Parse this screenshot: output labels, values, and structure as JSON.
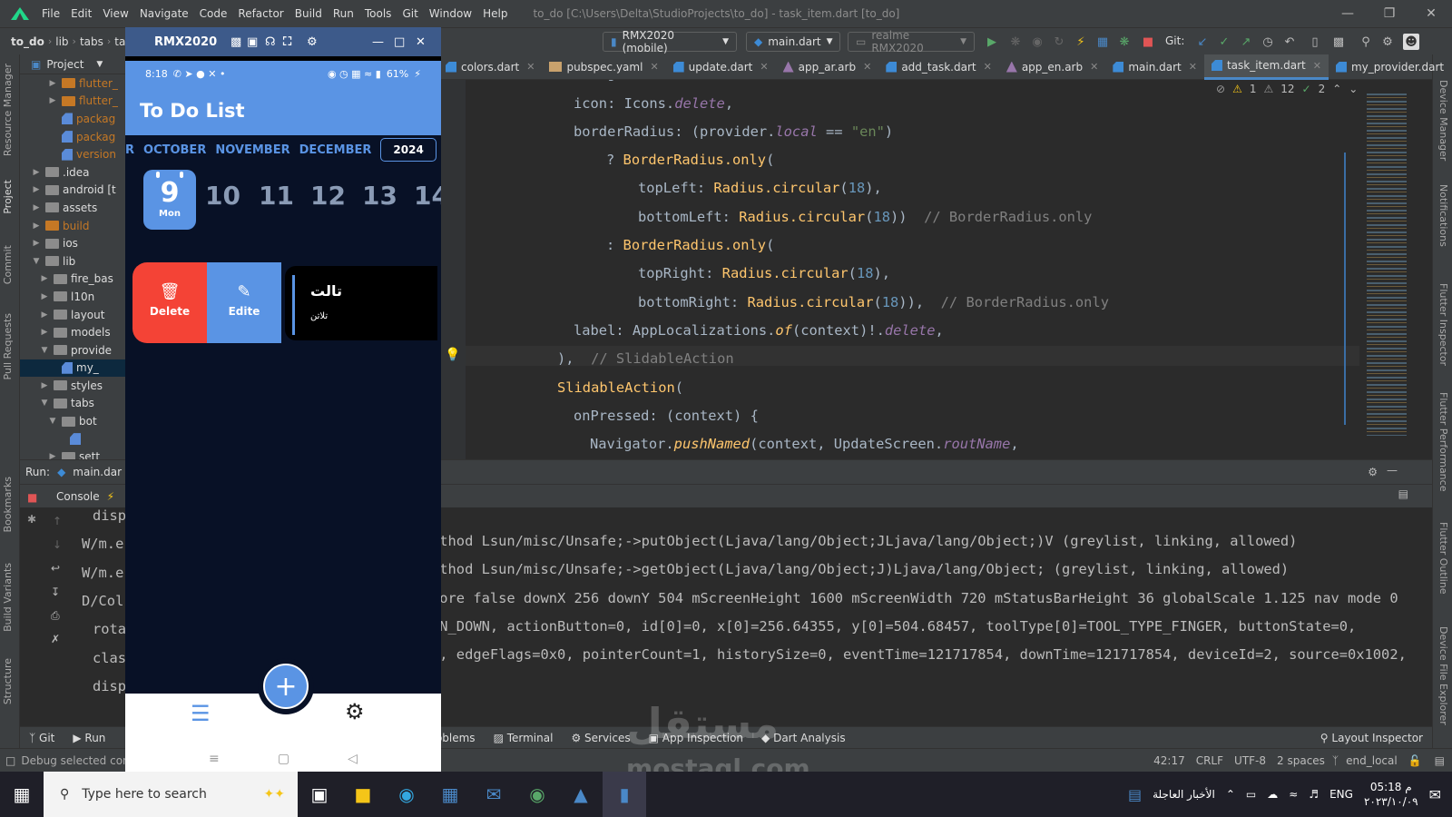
{
  "menubar": {
    "items": [
      "File",
      "Edit",
      "View",
      "Navigate",
      "Code",
      "Refactor",
      "Build",
      "Run",
      "Tools",
      "Git",
      "Window",
      "Help"
    ],
    "title": "to_do [C:\\Users\\Delta\\StudioProjects\\to_do] - task_item.dart [to_do]"
  },
  "navbar": {
    "breadcrumbs": [
      "to_do",
      "lib",
      "tabs",
      "ta"
    ],
    "device": "RMX2020 (mobile)",
    "run_config": "main.dart",
    "target": "realme RMX2020",
    "git_label": "Git:"
  },
  "editor_tabs": [
    {
      "label": "colors.dart",
      "icon": "dart-file-icon"
    },
    {
      "label": "pubspec.yaml",
      "icon": "yaml-file-icon"
    },
    {
      "label": "update.dart",
      "icon": "dart-file-icon"
    },
    {
      "label": "app_ar.arb",
      "icon": "arb-file-icon"
    },
    {
      "label": "add_task.dart",
      "icon": "dart-file-icon"
    },
    {
      "label": "app_en.arb",
      "icon": "arb-file-icon"
    },
    {
      "label": "main.dart",
      "icon": "dart-file-icon"
    },
    {
      "label": "task_item.dart",
      "icon": "dart-file-icon",
      "active": true
    },
    {
      "label": "my_provider.dart",
      "icon": "dart-file-icon"
    }
  ],
  "inspections": {
    "warn1": "1",
    "warn2": "12",
    "ok": "2"
  },
  "project_panel": {
    "title": "Project",
    "tree": [
      "flutter_",
      "flutter_",
      "packag",
      "packag",
      "version",
      ".idea",
      "android [t",
      "assets",
      "build",
      "ios",
      "lib",
      "fire_bas",
      "l10n",
      "layout",
      "models",
      "provide",
      "my_",
      "styles",
      "tabs",
      "bot",
      "",
      "sett"
    ]
  },
  "code_lines": [
    "backgroundColor: Colors.red,",
    "icon: Icons.delete,",
    "borderRadius: (provider.local == \"en\")",
    "? BorderRadius.only(",
    "topLeft: Radius.circular(18),",
    "bottomLeft: Radius.circular(18))  // BorderRadius.only",
    ": BorderRadius.only(",
    "topRight: Radius.circular(18),",
    "bottomRight: Radius.circular(18)),  // BorderRadius.only",
    "label: AppLocalizations.of(context)!.delete,",
    "),  // SlidableAction",
    "SlidableAction(",
    "onPressed: (context) {",
    "Navigator.pushNamed(context, UpdateScreen.routName,"
  ],
  "run_panel": {
    "run_label": "Run:",
    "run_config": "main.dar",
    "console_tab": "Console",
    "left_lines": [
      "disp",
      "W/m.e",
      "W/m.e",
      "D/Col",
      "rota",
      "clas",
      "disp"
    ],
    "log_lines": [
      "ethod Lsun/misc/Unsafe;->putObject(Ljava/lang/Object;JLjava/lang/Object;)V (greylist, linking, allowed)",
      "ethod Lsun/misc/Unsafe;->getObject(Ljava/lang/Object;J)Ljava/lang/Object; (greylist, linking, allowed)",
      "nore false downX 256 downY 504 mScreenHeight 1600 mScreenWidth 720 mStatusBarHeight 36 globalScale 1.125 nav mode 0",
      "ON_DOWN, actionButton=0, id[0]=0, x[0]=256.64355, y[0]=504.68457, toolType[0]=TOOL_TYPE_FINGER, buttonState=0,",
      "), edgeFlags=0x0, pointerCount=1, historySize=0, eventTime=121717854, downTime=121717854, deviceId=2, source=0x1002,"
    ]
  },
  "bottom_tabs": [
    "Git",
    "Run",
    "Problems",
    "Terminal",
    "Services",
    "App Inspection",
    "Dart Analysis"
  ],
  "layout_inspector": "Layout Inspector",
  "status": {
    "left": "Debug selected confi",
    "position": "42:17",
    "line_sep": "CRLF",
    "encoding": "UTF-8",
    "indent": "2 spaces",
    "branch": "end_local"
  },
  "left_strip": [
    "Resource Manager",
    "Project",
    "Commit",
    "Pull Requests",
    "Bookmarks",
    "Build Variants",
    "Structure"
  ],
  "right_strip": [
    "Device Manager",
    "Notifications",
    "Flutter Inspector",
    "Flutter Performance",
    "Flutter Outline",
    "Device File Explorer"
  ],
  "emulator": {
    "title": "RMX2020",
    "phone": {
      "time": "8:18",
      "battery": "61%",
      "app_title": "To Do List",
      "months": [
        "R",
        "OCTOBER",
        "NOVEMBER",
        "DECEMBER"
      ],
      "year": "2024",
      "selected_day": {
        "num": "9",
        "weekday": "Mon"
      },
      "days": [
        "10",
        "11",
        "12",
        "13",
        "14"
      ],
      "delete_label": "Delete",
      "edit_label": "Edite",
      "task_title": "تالت",
      "task_subtitle": "تلاتن"
    }
  },
  "taskbar": {
    "search_placeholder": "Type here to search",
    "news": "الأخبار العاجلة",
    "lang": "ENG",
    "time": "05:18 م",
    "date": "٢٠٢٣/١٠/٠٩"
  },
  "watermark": {
    "ar": "مستقل",
    "en": "mostaql.com"
  },
  "colors": {
    "accent": "#5a94e4",
    "delete": "#f44336",
    "phone_bg": "#081126"
  }
}
